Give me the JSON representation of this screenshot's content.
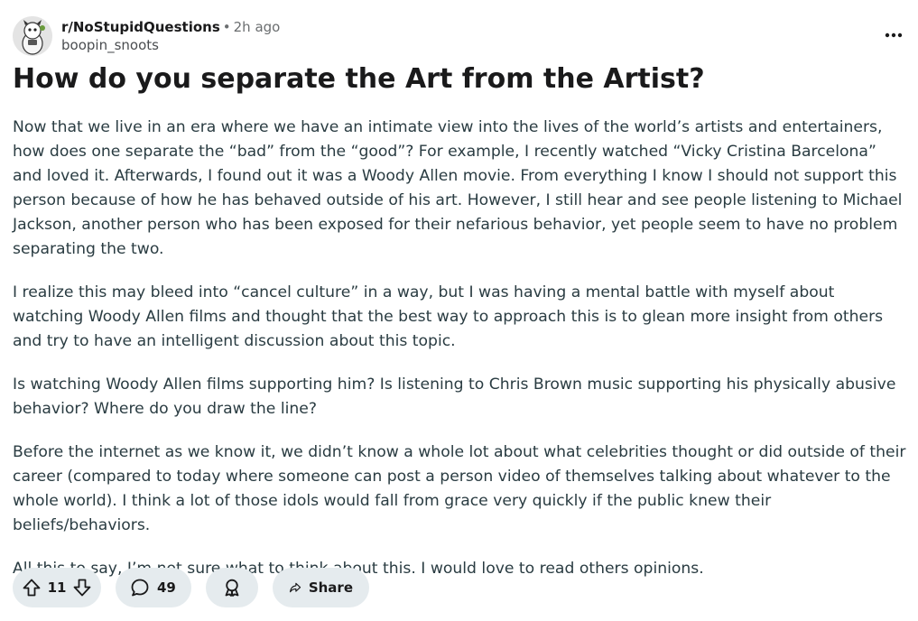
{
  "post": {
    "subreddit": "r/NoStupidQuestions",
    "separator": "•",
    "time_ago": "2h ago",
    "username": "boopin_snoots",
    "title": "How do you separate the Art from the Artist?",
    "paragraphs": [
      "Now that we live in an era where we have an intimate view into the lives of the world’s artists and entertainers, how does one separate the “bad” from the “good”? For example, I recently watched “Vicky Cristina Barcelona” and loved it. Afterwards, I found out it was a Woody Allen movie. From everything I know I should not support this person because of how he has behaved outside of his art. However, I still hear and see people listening to Michael Jackson, another person who has been exposed for their nefarious behavior, yet people seem to have no problem separating the two.",
      "I realize this may bleed into “cancel culture” in a way, but I was having a mental battle with myself about watching Woody Allen films and thought that the best way to approach this is to glean more insight from others and try to have an intelligent discussion about this topic.",
      "Is watching Woody Allen films supporting him? Is listening to Chris Brown music supporting his physically abusive behavior? Where do you draw the line?",
      "Before the internet as we know it, we didn’t know a whole lot about what celebrities thought or did outside of their career (compared to today where someone can post a person video of themselves talking about whatever to the whole world). I think a lot of those idols would fall from grace very quickly if the public knew their beliefs/behaviors.",
      "All this to say, I’m not sure what to think about this. I would love to read others opinions."
    ]
  },
  "actions": {
    "vote_count": "11",
    "comment_count": "49",
    "share_label": "Share"
  },
  "icons": {
    "more": "more-horizontal-icon",
    "upvote": "arrow-up-icon",
    "downvote": "arrow-down-icon",
    "comment": "comment-bubble-icon",
    "award": "award-ribbon-icon",
    "share": "share-arrow-icon"
  },
  "colors": {
    "pill_background": "#e5ebee",
    "body_text": "#2a3c42",
    "meta_text": "#6b6e70"
  }
}
